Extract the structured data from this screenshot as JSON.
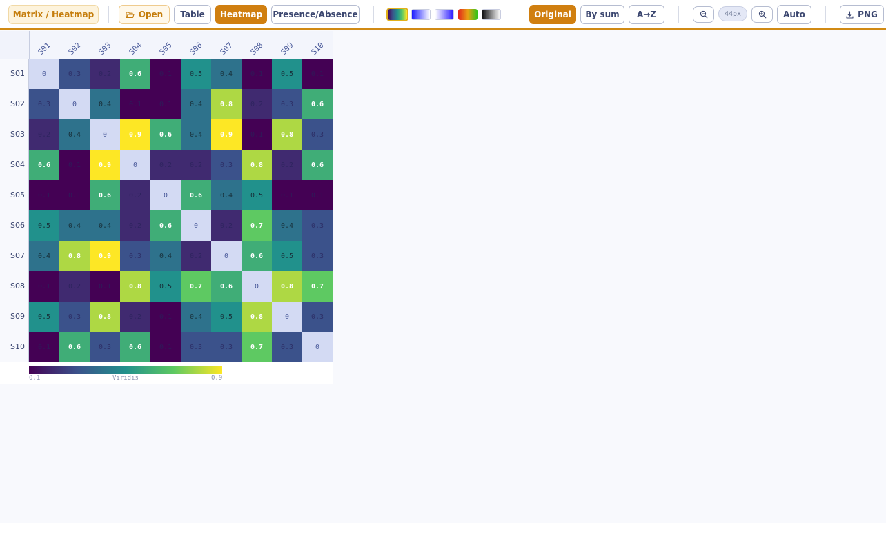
{
  "toolbar": {
    "brand": "Matrix / Heatmap",
    "open_label": "Open",
    "view_table": "Table",
    "view_heatmap": "Heatmap",
    "view_presence": "Presence/Absence",
    "palettes": [
      {
        "name": "viridis",
        "selected": true
      },
      {
        "name": "blue-white",
        "selected": false
      },
      {
        "name": "white-blue",
        "selected": false
      },
      {
        "name": "red-green",
        "selected": false
      },
      {
        "name": "black-white",
        "selected": false
      }
    ],
    "order_original": "Original",
    "order_by_sum": "By sum",
    "order_a_z": "A→Z",
    "zoom_value": "44px",
    "auto_label": "Auto",
    "png_label": "PNG"
  },
  "heatmap": {
    "labels": [
      "S01",
      "S02",
      "S03",
      "S04",
      "S05",
      "S06",
      "S07",
      "S08",
      "S09",
      "S10"
    ],
    "values": [
      [
        0,
        0.3,
        0.2,
        0.6,
        0.1,
        0.5,
        0.4,
        0.1,
        0.5,
        0.1
      ],
      [
        0.3,
        0,
        0.4,
        0.1,
        0.1,
        0.4,
        0.8,
        0.2,
        0.3,
        0.6
      ],
      [
        0.2,
        0.4,
        0,
        0.9,
        0.6,
        0.4,
        0.9,
        0.1,
        0.8,
        0.3
      ],
      [
        0.6,
        0.1,
        0.9,
        0,
        0.2,
        0.2,
        0.3,
        0.8,
        0.2,
        0.6
      ],
      [
        0.1,
        0.1,
        0.6,
        0.2,
        0,
        0.6,
        0.4,
        0.5,
        0.1,
        0.1
      ],
      [
        0.5,
        0.4,
        0.4,
        0.2,
        0.6,
        0,
        0.2,
        0.7,
        0.4,
        0.3
      ],
      [
        0.4,
        0.8,
        0.9,
        0.3,
        0.4,
        0.2,
        0,
        0.6,
        0.5,
        0.3
      ],
      [
        0.1,
        0.2,
        0.1,
        0.8,
        0.5,
        0.7,
        0.6,
        0,
        0.8,
        0.7
      ],
      [
        0.5,
        0.3,
        0.8,
        0.2,
        0.1,
        0.4,
        0.5,
        0.8,
        0,
        0.3
      ],
      [
        0.1,
        0.6,
        0.3,
        0.6,
        0.1,
        0.3,
        0.3,
        0.7,
        0.3,
        0
      ]
    ],
    "diagonal_color": "#d3daf3"
  },
  "legend": {
    "min": "0.1",
    "name": "Viridis",
    "max": "0.9"
  }
}
